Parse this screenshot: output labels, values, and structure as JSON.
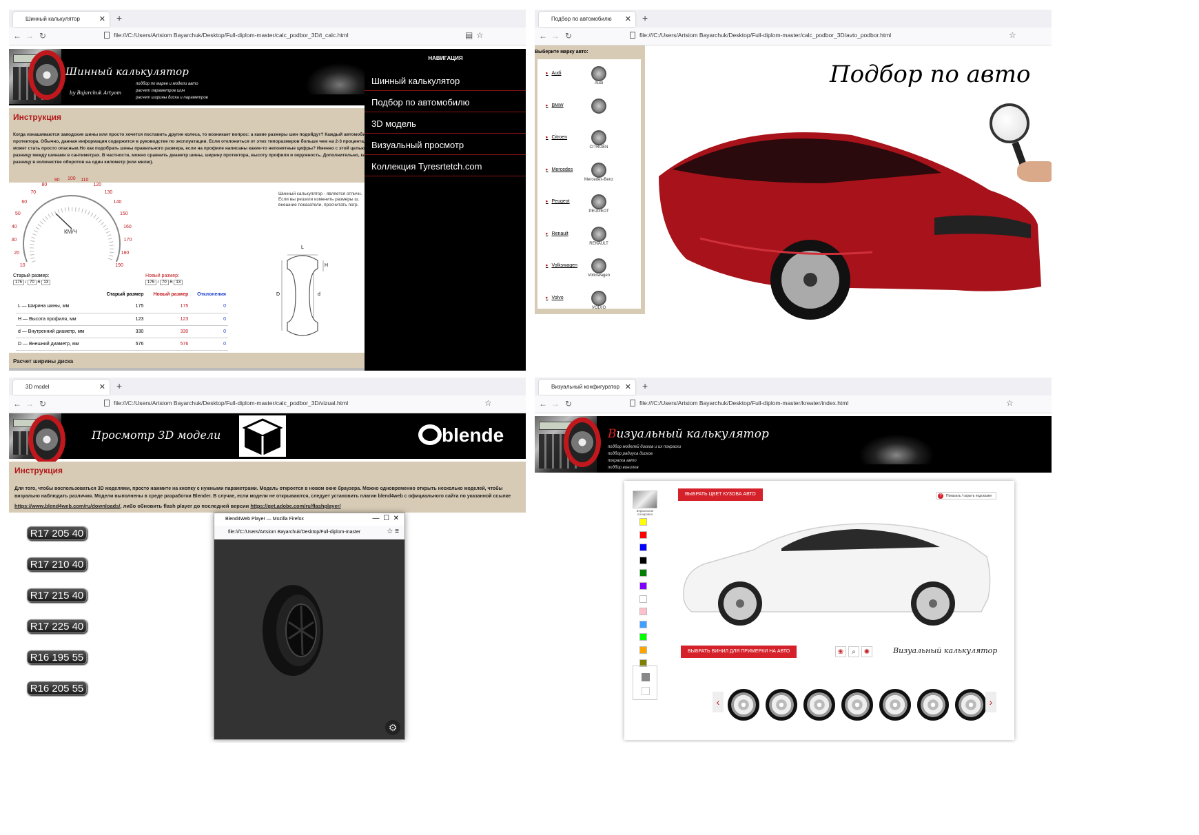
{
  "win1": {
    "tab_title": "Шинный калькулятор",
    "url": "file:///C:/Users/Artsiom Bayarchuk/Desktop/Full-diplom-master/calc_podbor_3D/t_calc.html",
    "header_title": "Шинный калькулятор",
    "header_author": "by Bajarchuk Artyom",
    "header_bullets": [
      "подбор по марке и модели авто",
      "расчет параметров шин",
      "расчет ширины диска и параметров"
    ],
    "nav_heading": "НАВИГАЦИЯ",
    "nav_items": [
      "Шинный калькулятор",
      "Подбор по автомобилю",
      "3D модель",
      "Визуальный просмотр",
      "Коллекция Tyresrtetch.com"
    ],
    "instruction_title": "Инструкция",
    "instruction_text": "Когда изнашиваются заводские шины или просто хочется поставить другие колеса, то возникает вопрос: а какие размеры шин подойдут? Каждый автомобиль рассчитан под определенный диаметр колес и ширину протектора. Обычно, данная информация содержится в руководстве по эксплуатации. Если отклониться от этих типоразмеров больше чем на 2-3 процента, то расход бензина вырастет, спидометр начнет врать, а вождение может стать просто опасным.Но как подобрать шины правильного размера, если на профиле написаны какие-то непонятные цифры? Именно с этой целью и создан данный шинный калькулятор. Он позволяет определить разницу между шинами в сантиметрах. В частности, можно сравнить диаметр шины, ширину протектора, высоту профиля и окружность. Дополнительно, калькулятор определяет потенциальные изменения клиренса и разницу в количестве оборотов на один километр (или милю).",
    "speedo_unit": "КМ/Ч",
    "speedo_ticks": [
      "10",
      "20",
      "30",
      "40",
      "50",
      "60",
      "70",
      "80",
      "90",
      "100",
      "110",
      "120",
      "130",
      "140",
      "150",
      "160",
      "170",
      "180",
      "190"
    ],
    "side_text": "Шинный калькулятор - является отличн. Если вы решили изменить размеры ш. внешние показатели, просчитать погр.",
    "old_size_label": "Старый размер:",
    "new_size_label": "Новый размер:",
    "old_size": [
      "175",
      "70",
      "13"
    ],
    "new_size": [
      "175",
      "70",
      "13"
    ],
    "r_label": "R",
    "table_headers": [
      "Старый размер",
      "Новый размер",
      "Отклонения"
    ],
    "table_rows": [
      {
        "label": "L — Ширина шины, мм",
        "old": "175",
        "new": "175",
        "diff": "0"
      },
      {
        "label": "H — Высота профиля, мм",
        "old": "123",
        "new": "123",
        "diff": "0"
      },
      {
        "label": "d — Внутренний диаметр, мм",
        "old": "330",
        "new": "330",
        "diff": "0"
      },
      {
        "label": "D — Внешний диаметр, мм",
        "old": "576",
        "new": "576",
        "diff": "0"
      }
    ],
    "diagram_labels": [
      "L",
      "H",
      "D",
      "d"
    ],
    "disk_section": "Расчет ширины диска"
  },
  "win2": {
    "tab_title": "Подбор по автомобилю",
    "url": "file:///C:/Users/Artsiom Bayarchuk/Desktop/Full-diplom-master/calc_podbor_3D/avto_podbor.html",
    "select_label": "Выберите марку авто:",
    "brands": [
      {
        "name": "Audi",
        "logo": "Audi"
      },
      {
        "name": "BMW",
        "logo": ""
      },
      {
        "name": "Citroen",
        "logo": "CITROËN"
      },
      {
        "name": "Mercedes",
        "logo": "Mercedes-Benz"
      },
      {
        "name": "Peugeot",
        "logo": "PEUGEOT"
      },
      {
        "name": "Renault",
        "logo": "RENAULT"
      },
      {
        "name": "Volkswagen",
        "logo": "Volkswagen"
      },
      {
        "name": "Volvo",
        "logo": "VOLVO"
      }
    ],
    "heading": "Подбор по авто"
  },
  "win3": {
    "tab_title": "3D model",
    "url": "file:///C:/Users/Artsiom Bayarchuk/Desktop/Full-diplom-master/calc_podbor_3D/vizual.html",
    "header_title": "Просмотр 3D модели",
    "blender_text": "blende",
    "instruction_title": "Инструкция",
    "instruction_text": "Для того, чтобы воспользоваться 3D моделями, просто нажмите на кнопку с нужными параметрами. Модель откроется в новом окне браузера. Можно одновременно открыть несколько моделей, чтобы визуально наблюдать различия. Модели выполнены в среде разработки Blender. В случае, если модели не открываются, следует установить плагин blend4web с официального сайта по указанной ссылке",
    "link1": "https://www.blend4web.com/ru/downloads/",
    "link_mid": ", либо обновить flash player до последней версии ",
    "link2": "https://get.adobe.com/ru/flashplayer/",
    "size_buttons": [
      "R17 205 40",
      "R17 210 40",
      "R17 215 40",
      "R17 225 40",
      "R16 195 55",
      "R16 205 55"
    ],
    "popup_title": "Blend4Web Player — Mozilla Firefox",
    "popup_url": "file:///C:/Users/Artsiom Bayarchuk/Desktop/Full-diplom-master"
  },
  "win4": {
    "tab_title": "Визуальный конфигуратор",
    "url": "file:///C:/Users/Artsiom Bayarchuk/Desktop/Full-diplom-master/kreater/index.html",
    "header_title_first": "В",
    "header_title_rest": "изуальный калькулятор",
    "header_bullets": [
      "подбор моделей дисков и их покраски",
      "подбор радиуса дисков",
      "покраска авто",
      "подбор винилов"
    ],
    "body_color_button": "ВЫБРАТЬ ЦВЕТ КУЗОВА АВТО",
    "hints_button": "Показать / скрыть подсказки",
    "mirror_label": "Зеркальная полировка",
    "vinyl_button": "ВЫБРАТЬ ВИНИЛ ДЛЯ ПРИМЕРКИ НА АВТО",
    "footer_title": "Визуальный калькулятор",
    "colors": [
      "#ffff00",
      "#ff0000",
      "#0000ff",
      "#000000",
      "#008000",
      "#8000ff",
      "#ffffff",
      "#ffc0cb",
      "#40a0ff",
      "#00ff00",
      "#ffa500",
      "#808000"
    ],
    "wheel_count": 7
  }
}
